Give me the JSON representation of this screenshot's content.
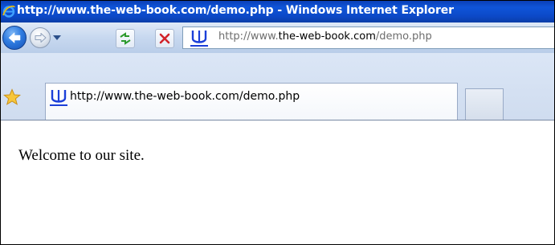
{
  "window": {
    "title": "http://www.the-web-book.com/demo.php - Windows Internet Explorer"
  },
  "navbar": {
    "address_prefix": "http://www.",
    "address_domain": "the-web-book.com",
    "address_path": "/demo.php",
    "icons": {
      "back": "back-arrow-icon",
      "forward": "forward-arrow-icon",
      "history": "chevron-down-icon",
      "refresh": "refresh-icon",
      "stop": "stop-x-icon",
      "site": "site-favicon-icon"
    }
  },
  "tabbar": {
    "favorites_icon": "favorites-star-icon",
    "tabs": [
      {
        "label": "http://www.the-web-book.com/demo.php",
        "icon": "site-favicon-icon",
        "active": true
      }
    ]
  },
  "content": {
    "text": "Welcome to our site."
  },
  "colors": {
    "titlebar": "#0c49c8",
    "chrome": "#c7d8ef",
    "favicon": "#1b3fd8"
  }
}
